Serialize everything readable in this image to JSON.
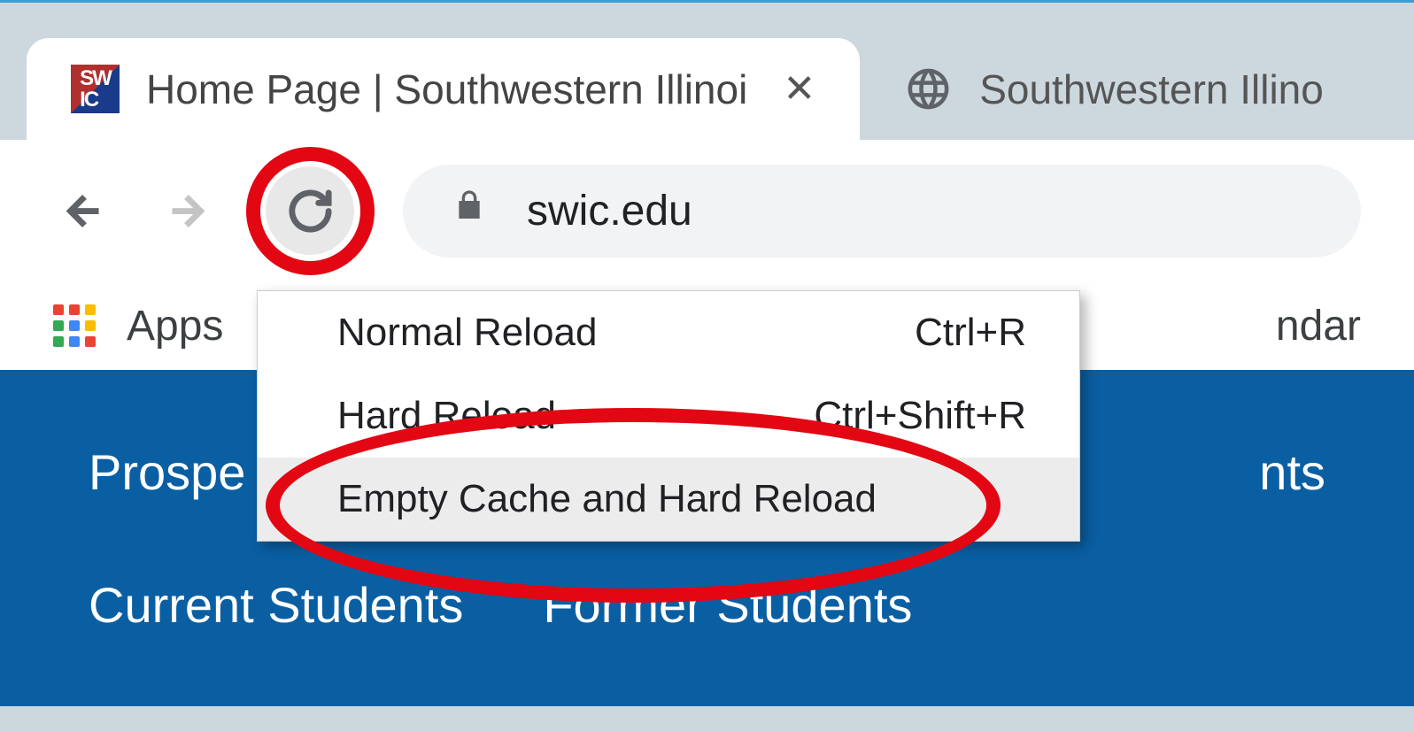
{
  "tabs": {
    "active_title": "Home Page | Southwestern Illinoi",
    "inactive_title": "Southwestern Illino"
  },
  "toolbar": {
    "url": "swic.edu"
  },
  "bookmarks": {
    "apps_label": "Apps",
    "right_fragment": "ndar"
  },
  "context_menu": {
    "items": [
      {
        "label": "Normal Reload",
        "shortcut": "Ctrl+R"
      },
      {
        "label": "Hard Reload",
        "shortcut": "Ctrl+Shift+R"
      },
      {
        "label": "Empty Cache and Hard Reload",
        "shortcut": ""
      }
    ]
  },
  "page_nav": {
    "row1_left": "Prospe",
    "row1_right": "nts",
    "row2_a": "Current Students",
    "row2_b": "Former Students"
  },
  "annotation": {
    "highlight_color": "#e30613"
  }
}
